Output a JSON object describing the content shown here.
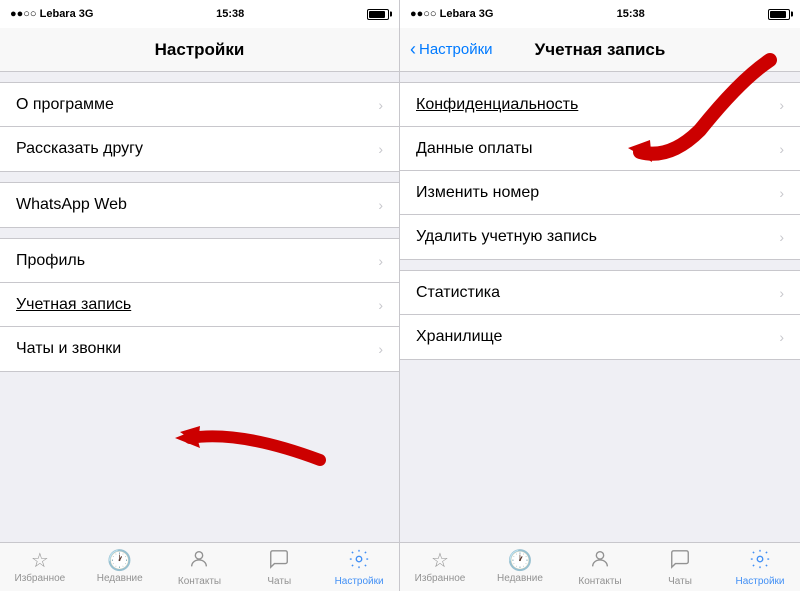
{
  "left_panel": {
    "status_bar": {
      "signal": "●●○○ Lebara  3G",
      "time": "15:38",
      "battery": "▮"
    },
    "nav_title": "Настройки",
    "sections": [
      {
        "id": "top",
        "items": [
          {
            "label": "О программе",
            "underlined": false
          },
          {
            "label": "Рассказать другу",
            "underlined": false
          }
        ]
      },
      {
        "id": "whatsapp",
        "items": [
          {
            "label": "WhatsApp Web",
            "underlined": false
          }
        ]
      },
      {
        "id": "account",
        "items": [
          {
            "label": "Профиль",
            "underlined": false
          },
          {
            "label": "Учетная запись",
            "underlined": true
          },
          {
            "label": "Чаты и звонки",
            "underlined": false
          }
        ]
      }
    ],
    "tabs": [
      {
        "icon": "☆",
        "label": "Избранное",
        "active": false
      },
      {
        "icon": "⏱",
        "label": "Недавние",
        "active": false
      },
      {
        "icon": "👤",
        "label": "Контакты",
        "active": false
      },
      {
        "icon": "💬",
        "label": "Чаты",
        "active": false
      },
      {
        "icon": "⚙",
        "label": "Настройки",
        "active": true
      }
    ]
  },
  "right_panel": {
    "status_bar": {
      "signal": "●●○○ Lebara  3G",
      "time": "15:38"
    },
    "nav_back": "Настройки",
    "nav_title": "Учетная запись",
    "sections": [
      {
        "id": "account-items",
        "items": [
          {
            "label": "Конфиденциальность",
            "underlined": true
          },
          {
            "label": "Данные оплаты",
            "underlined": false
          },
          {
            "label": "Изменить номер",
            "underlined": false
          },
          {
            "label": "Удалить учетную запись",
            "underlined": false
          }
        ]
      },
      {
        "id": "storage-items",
        "items": [
          {
            "label": "Статистика",
            "underlined": false
          },
          {
            "label": "Хранилище",
            "underlined": false
          }
        ]
      }
    ],
    "tabs": [
      {
        "icon": "☆",
        "label": "Избранное",
        "active": false
      },
      {
        "icon": "⏱",
        "label": "Недавние",
        "active": false
      },
      {
        "icon": "👤",
        "label": "Контакты",
        "active": false
      },
      {
        "icon": "💬",
        "label": "Чаты",
        "active": false
      },
      {
        "icon": "⚙",
        "label": "Настройки",
        "active": true
      }
    ]
  },
  "chevron": "›"
}
